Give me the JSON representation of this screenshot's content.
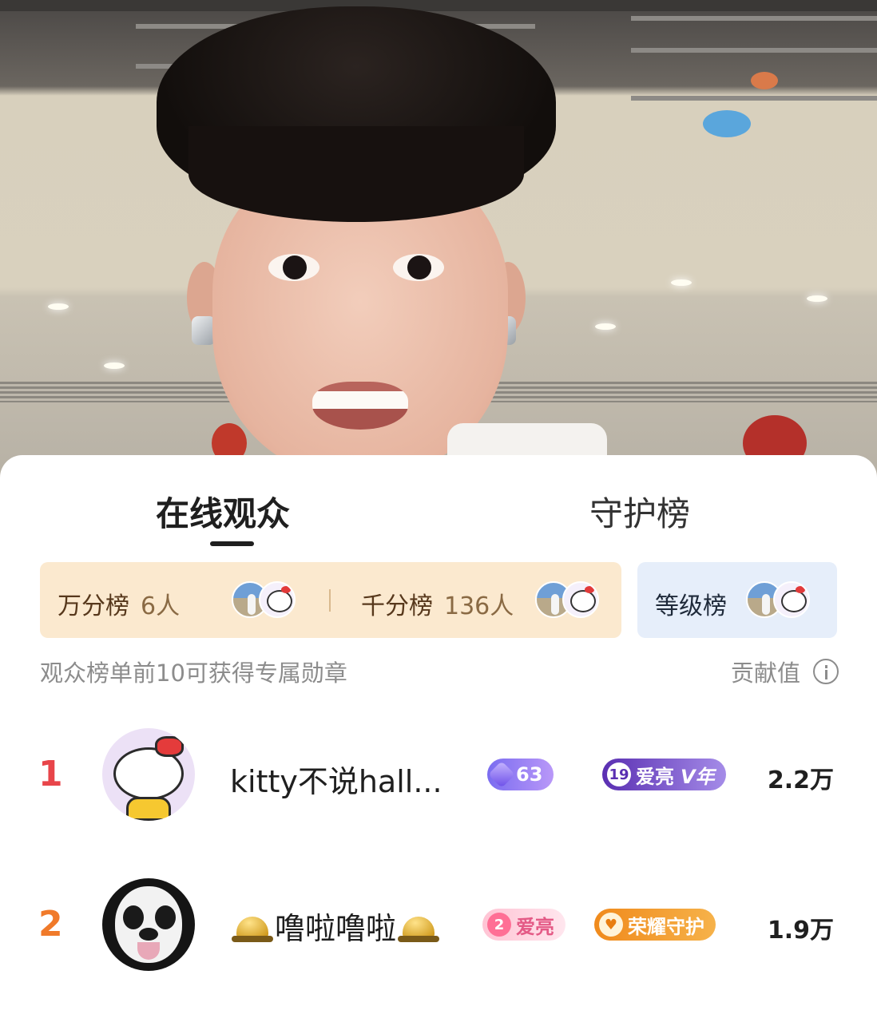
{
  "tabs": [
    {
      "label": "在线观众",
      "active": true
    },
    {
      "label": "守护榜",
      "active": false
    }
  ],
  "rank_cards": {
    "wan": {
      "name": "万分榜",
      "count": "6人"
    },
    "qian": {
      "name": "千分榜",
      "count": "136人"
    },
    "level": {
      "name": "等级榜"
    }
  },
  "hint": "观众榜单前10可获得专属勋章",
  "contrib_label": "贡献值",
  "viewers": [
    {
      "rank": "1",
      "rank_color": "#e8454a",
      "name": "kitty不说hall...",
      "badges": {
        "level": "63",
        "fan_level": "19",
        "fan_label": "爱亮",
        "fan_suffix": "V年"
      },
      "score": "2.2万"
    },
    {
      "rank": "2",
      "rank_color": "#f07a2a",
      "name": "噜啦噜啦",
      "badges": {
        "fan_level": "2",
        "fan_label": "爱亮",
        "guard_label": "荣耀守护"
      },
      "score": "1.9万"
    }
  ],
  "icons": [
    "info-icon",
    "bell-icon",
    "gem-icon",
    "shield-icon"
  ]
}
